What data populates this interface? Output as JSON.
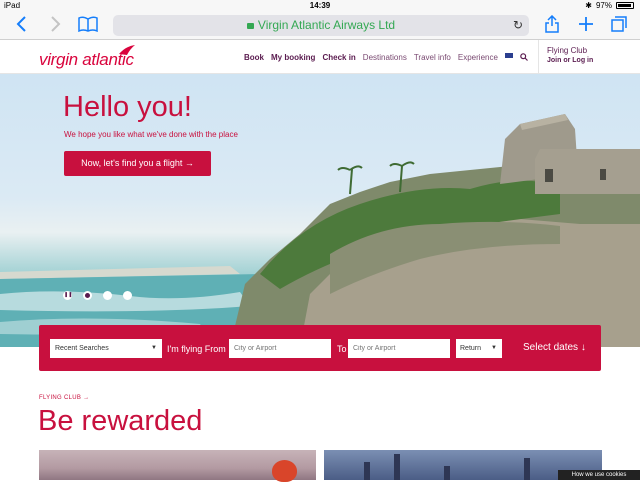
{
  "statusbar": {
    "device": "iPad",
    "time": "14:39",
    "battery": "97%"
  },
  "browser": {
    "url_title": "Virgin Atlantic Airways Ltd"
  },
  "header": {
    "logo": "virgin atlantic",
    "nav": [
      {
        "label": "Book",
        "style": "strong"
      },
      {
        "label": "My booking",
        "style": "strong"
      },
      {
        "label": "Check in",
        "style": "strong"
      },
      {
        "label": "Destinations",
        "style": "light"
      },
      {
        "label": "Travel info",
        "style": "light"
      },
      {
        "label": "Experience",
        "style": "light"
      }
    ],
    "flying_club_title": "Flying Club",
    "flying_club_login": "Join or Log in"
  },
  "hero": {
    "title": "Hello you!",
    "subtitle": "We hope you like what we've done with the place",
    "cta": "Now, let's find you a flight →"
  },
  "search": {
    "recent": "Recent Searches",
    "from_label": "I'm flying From",
    "from_placeholder": "City or Airport",
    "to_label": "To",
    "to_placeholder": "City or Airport",
    "trip_type": "Return",
    "select_dates": "Select dates ↓"
  },
  "rewards": {
    "label": "FLYING CLUB →",
    "heading": "Be rewarded"
  },
  "cookie": "How we use cookies",
  "colors": {
    "brand_red": "#c8103e",
    "brand_purple": "#5a1b4f",
    "ios_blue": "#157efb"
  }
}
